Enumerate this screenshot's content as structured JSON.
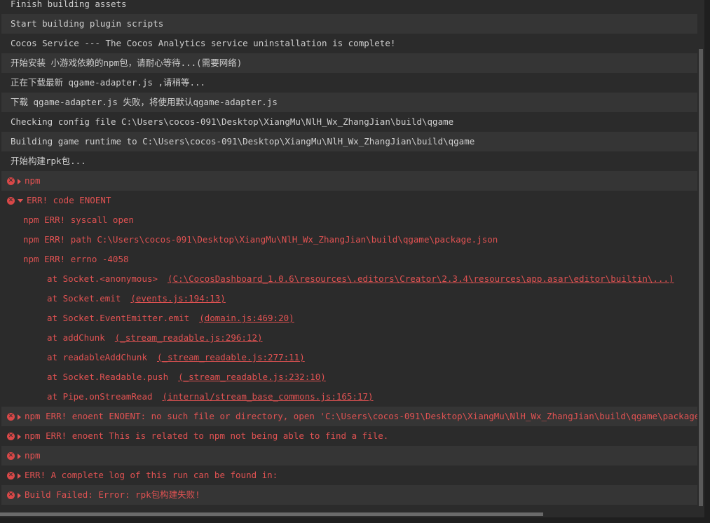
{
  "log": {
    "line_0": "Finish building assets",
    "line_1": "Start building plugin scripts",
    "line_2": "Cocos Service --- The Cocos Analytics service uninstallation is complete!",
    "line_3": "开始安装 小游戏依赖的npm包，请耐心等待...(需要网络)",
    "line_4": "正在下载最新 qgame-adapter.js ,请稍等...",
    "line_5": "下载 qgame-adapter.js 失败，将使用默认qgame-adapter.js",
    "line_6": "Checking config file C:\\Users\\cocos-091\\Desktop\\XiangMu\\NlH_Wx_ZhangJian\\build\\qgame",
    "line_7": "Building game runtime to C:\\Users\\cocos-091\\Desktop\\XiangMu\\NlH_Wx_ZhangJian\\build\\qgame",
    "line_8": "开始构建rpk包...",
    "err_npm_1": "npm",
    "err_code": "ERR! code ENOENT",
    "sub_syscall": "npm ERR! syscall open",
    "sub_path": "npm ERR! path C:\\Users\\cocos-091\\Desktop\\XiangMu\\NlH_Wx_ZhangJian\\build\\qgame\\package.json",
    "sub_errno": "npm ERR! errno -4058",
    "stack_0_fn": "at Socket.<anonymous>",
    "stack_0_loc": "(C:\\CocosDashboard_1.0.6\\resources\\.editors\\Creator\\2.3.4\\resources\\app.asar\\editor\\builtin\\...)",
    "stack_1_fn": "at Socket.emit",
    "stack_1_loc": "(events.js:194:13)",
    "stack_2_fn": "at Socket.EventEmitter.emit",
    "stack_2_loc": "(domain.js:469:20)",
    "stack_3_fn": "at addChunk",
    "stack_3_loc": "(_stream_readable.js:296:12)",
    "stack_4_fn": "at readableAddChunk",
    "stack_4_loc": "(_stream_readable.js:277:11)",
    "stack_5_fn": "at Socket.Readable.push",
    "stack_5_loc": "(_stream_readable.js:232:10)",
    "stack_6_fn": "at Pipe.onStreamRead",
    "stack_6_loc": "(internal/stream_base_commons.js:165:17)",
    "err_enoent": "npm ERR! enoent ENOENT: no such file or directory, open 'C:\\Users\\cocos-091\\Desktop\\XiangMu\\NlH_Wx_ZhangJian\\build\\qgame\\package.json'",
    "err_related": "npm ERR! enoent This is related to npm not being able to find a file.",
    "err_npm_2": "npm",
    "err_complete_log": "ERR! A complete log of this run can be found in:",
    "err_build_failed": "Build Failed: Error: rpk包构建失败!"
  },
  "icons": {
    "error": "error-circle-icon",
    "expand_collapsed": "caret-right-icon",
    "expand_open": "caret-down-icon"
  },
  "colors": {
    "background": "#2b2b2b",
    "alt_row": "#353535",
    "text": "#cfcfcf",
    "error": "#e05252"
  }
}
